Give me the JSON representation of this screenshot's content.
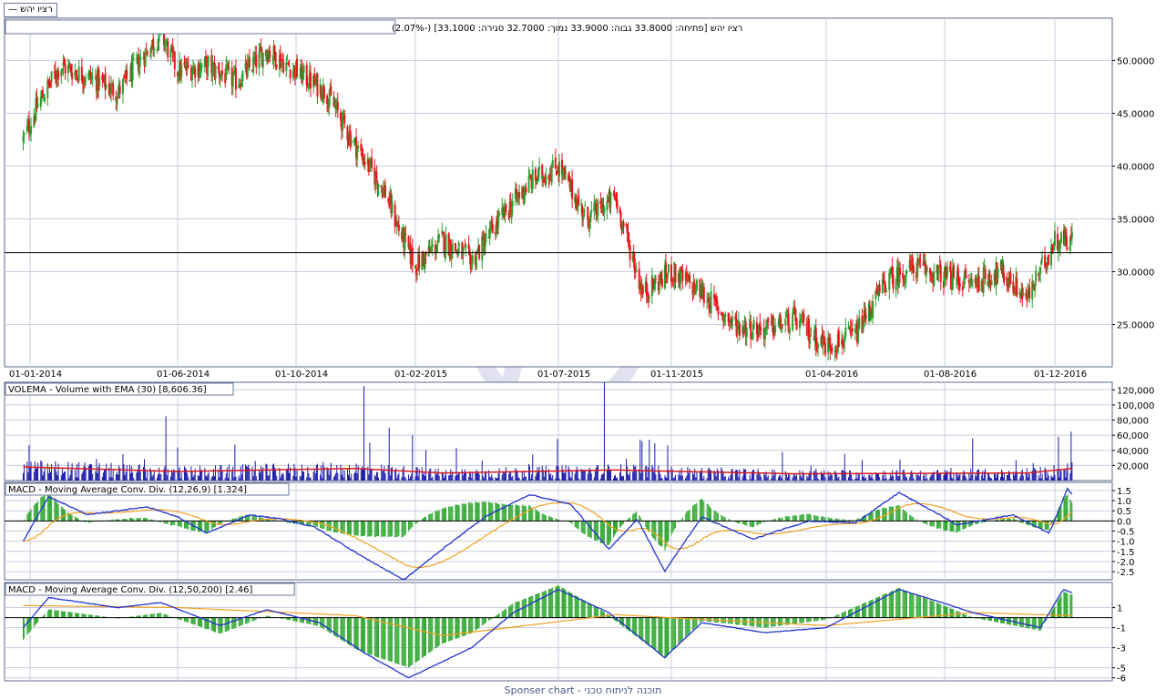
{
  "legend_label": "רציו יהש —",
  "info_bar": "רציו יהש [פתיחה: 33.8000  גבוה: 33.9000  נמוך: 32.7000  סגירה: 33.1000] (-2.07%)",
  "footer": "Sponser chart - תוכנה לניתוח טכני",
  "colors": {
    "up": "#2e9e2e",
    "down": "#e8141a",
    "volume": "#1a1aa8",
    "ema": "#d81a1a",
    "macd": "#2233cc",
    "signal": "#f0a020",
    "hist": "#32a832",
    "grid": "#c8cce0"
  },
  "chart_data": [
    {
      "type": "candlestick",
      "title": "רציו יהש",
      "x_ticks": [
        "01-01-2014",
        "01-06-2014",
        "01-10-2014",
        "01-02-2015",
        "01-07-2015",
        "01-11-2015",
        "01-04-2016",
        "01-08-2016",
        "01-12-2016"
      ],
      "y_ticks": [
        "50.0000",
        "45.0000",
        "40.0000",
        "35.0000",
        "30.0000",
        "25.0000"
      ],
      "ylim": [
        21.0,
        54.0
      ],
      "reference_line": 31.8,
      "keypoints": [
        {
          "date": "2013-12-25",
          "value": 42.5
        },
        {
          "date": "2014-01-10",
          "value": 46
        },
        {
          "date": "2014-02-01",
          "value": 49.5
        },
        {
          "date": "2014-03-01",
          "value": 48.5
        },
        {
          "date": "2014-04-01",
          "value": 47
        },
        {
          "date": "2014-05-01",
          "value": 51
        },
        {
          "date": "2014-05-15",
          "value": 52.5
        },
        {
          "date": "2014-06-01",
          "value": 49
        },
        {
          "date": "2014-07-01",
          "value": 49.5
        },
        {
          "date": "2014-08-01",
          "value": 48
        },
        {
          "date": "2014-09-01",
          "value": 51
        },
        {
          "date": "2014-10-01",
          "value": 49
        },
        {
          "date": "2014-11-01",
          "value": 47
        },
        {
          "date": "2014-12-01",
          "value": 42
        },
        {
          "date": "2015-01-01",
          "value": 37.5
        },
        {
          "date": "2015-01-15",
          "value": 34
        },
        {
          "date": "2015-02-01",
          "value": 30.5
        },
        {
          "date": "2015-03-01",
          "value": 33
        },
        {
          "date": "2015-04-01",
          "value": 31
        },
        {
          "date": "2015-05-01",
          "value": 35
        },
        {
          "date": "2015-06-01",
          "value": 38.5
        },
        {
          "date": "2015-07-01",
          "value": 40
        },
        {
          "date": "2015-08-01",
          "value": 35
        },
        {
          "date": "2015-09-01",
          "value": 37
        },
        {
          "date": "2015-10-01",
          "value": 28
        },
        {
          "date": "2015-11-01",
          "value": 30
        },
        {
          "date": "2015-12-01",
          "value": 28
        },
        {
          "date": "2016-01-01",
          "value": 25
        },
        {
          "date": "2016-02-01",
          "value": 24.5
        },
        {
          "date": "2016-03-01",
          "value": 25.5
        },
        {
          "date": "2016-04-01",
          "value": 23
        },
        {
          "date": "2016-05-01",
          "value": 24
        },
        {
          "date": "2016-06-01",
          "value": 29
        },
        {
          "date": "2016-07-01",
          "value": 30.5
        },
        {
          "date": "2016-08-01",
          "value": 29.5
        },
        {
          "date": "2016-09-01",
          "value": 29
        },
        {
          "date": "2016-10-01",
          "value": 30
        },
        {
          "date": "2016-11-01",
          "value": 27.5
        },
        {
          "date": "2016-12-01",
          "value": 33
        },
        {
          "date": "2016-12-20",
          "value": 33.1
        }
      ]
    },
    {
      "type": "bar",
      "title": "VOLEMA - Volume with EMA (30) [8,606.36]",
      "y_ticks": [
        "120,000",
        "100,000",
        "80,000",
        "60,000",
        "40,000",
        "20,000"
      ],
      "ylim": [
        0,
        130000
      ],
      "series": [
        {
          "name": "Volume"
        },
        {
          "name": "EMA (30)"
        }
      ],
      "ema_keypoints": [
        {
          "date": "2013-12-25",
          "value": 18000
        },
        {
          "date": "2014-06-01",
          "value": 12000
        },
        {
          "date": "2014-12-01",
          "value": 16000
        },
        {
          "date": "2015-03-01",
          "value": 10000
        },
        {
          "date": "2015-09-01",
          "value": 14000
        },
        {
          "date": "2016-03-01",
          "value": 9000
        },
        {
          "date": "2016-11-01",
          "value": 10000
        },
        {
          "date": "2016-12-20",
          "value": 16000
        }
      ],
      "spikes": [
        {
          "date": "2014-05-20",
          "value": 85000
        },
        {
          "date": "2014-12-10",
          "value": 125000
        },
        {
          "date": "2015-01-05",
          "value": 70000
        },
        {
          "date": "2015-04-25",
          "value": 60000
        },
        {
          "date": "2015-08-20",
          "value": 130000
        },
        {
          "date": "2016-03-25",
          "value": 105000
        },
        {
          "date": "2016-12-05",
          "value": 58000
        }
      ]
    },
    {
      "type": "line",
      "title": "MACD - Moving Average Conv. Div. (12,26,9) [1.324]",
      "y_ticks": [
        "1.5",
        "1.0",
        "0.5",
        "0.0",
        "-0.5",
        "-1.0",
        "-1.5",
        "-2.0",
        "-2.5"
      ],
      "ylim": [
        -2.9,
        1.9
      ],
      "series": [
        {
          "name": "MACD"
        },
        {
          "name": "Signal"
        }
      ],
      "macd_keypoints": [
        {
          "date": "2013-12-25",
          "value": -1.0
        },
        {
          "date": "2014-01-20",
          "value": 1.2
        },
        {
          "date": "2014-03-01",
          "value": 0.3
        },
        {
          "date": "2014-05-01",
          "value": 0.7
        },
        {
          "date": "2014-06-01",
          "value": 0.2
        },
        {
          "date": "2014-07-01",
          "value": -0.6
        },
        {
          "date": "2014-08-15",
          "value": 0.3
        },
        {
          "date": "2014-09-15",
          "value": 0.1
        },
        {
          "date": "2014-10-20",
          "value": -0.3
        },
        {
          "date": "2014-12-10",
          "value": -1.8
        },
        {
          "date": "2015-01-20",
          "value": -2.9
        },
        {
          "date": "2015-03-01",
          "value": -1.4
        },
        {
          "date": "2015-04-15",
          "value": 0.2
        },
        {
          "date": "2015-06-01",
          "value": 1.3
        },
        {
          "date": "2015-07-15",
          "value": 0.8
        },
        {
          "date": "2015-08-25",
          "value": -1.4
        },
        {
          "date": "2015-09-25",
          "value": 0.1
        },
        {
          "date": "2015-10-25",
          "value": -2.5
        },
        {
          "date": "2015-12-01",
          "value": 0.2
        },
        {
          "date": "2016-01-20",
          "value": -0.9
        },
        {
          "date": "2016-03-15",
          "value": 0.0
        },
        {
          "date": "2016-05-01",
          "value": -0.1
        },
        {
          "date": "2016-06-15",
          "value": 1.4
        },
        {
          "date": "2016-08-15",
          "value": -0.2
        },
        {
          "date": "2016-10-15",
          "value": 0.3
        },
        {
          "date": "2016-11-25",
          "value": -0.6
        },
        {
          "date": "2016-12-15",
          "value": 1.6
        },
        {
          "date": "2016-12-20",
          "value": 1.3
        }
      ]
    },
    {
      "type": "line",
      "title": "MACD - Moving Average Conv. Div. (12,50,200) [2.46]",
      "y_ticks": [
        "1",
        "-1",
        "-3",
        "-5",
        "-6"
      ],
      "ylim": [
        -6.3,
        3.5
      ],
      "series": [
        {
          "name": "MACD"
        },
        {
          "name": "Signal"
        }
      ],
      "macd_keypoints": [
        {
          "date": "2013-12-25",
          "value": -1.0
        },
        {
          "date": "2014-01-20",
          "value": 2.0
        },
        {
          "date": "2014-04-01",
          "value": 1.0
        },
        {
          "date": "2014-05-15",
          "value": 1.5
        },
        {
          "date": "2014-07-15",
          "value": -0.8
        },
        {
          "date": "2014-09-01",
          "value": 0.8
        },
        {
          "date": "2014-10-25",
          "value": -0.5
        },
        {
          "date": "2014-12-10",
          "value": -3.5
        },
        {
          "date": "2015-01-25",
          "value": -6.0
        },
        {
          "date": "2015-04-01",
          "value": -3.0
        },
        {
          "date": "2015-05-15",
          "value": 0.5
        },
        {
          "date": "2015-07-01",
          "value": 2.8
        },
        {
          "date": "2015-08-25",
          "value": 0.5
        },
        {
          "date": "2015-10-25",
          "value": -4.0
        },
        {
          "date": "2015-12-01",
          "value": -0.5
        },
        {
          "date": "2016-02-01",
          "value": -1.5
        },
        {
          "date": "2016-04-01",
          "value": -1.0
        },
        {
          "date": "2016-06-15",
          "value": 2.8
        },
        {
          "date": "2016-09-01",
          "value": 0.5
        },
        {
          "date": "2016-11-15",
          "value": -1.0
        },
        {
          "date": "2016-12-10",
          "value": 2.8
        },
        {
          "date": "2016-12-20",
          "value": 2.5
        }
      ],
      "signal_keypoints": [
        {
          "date": "2013-12-25",
          "value": 1.2
        },
        {
          "date": "2014-06-01",
          "value": 1.0
        },
        {
          "date": "2014-12-01",
          "value": 0.2
        },
        {
          "date": "2015-03-01",
          "value": -1.8
        },
        {
          "date": "2015-09-01",
          "value": 0.3
        },
        {
          "date": "2016-04-01",
          "value": -0.8
        },
        {
          "date": "2016-09-01",
          "value": 0.5
        },
        {
          "date": "2016-12-20",
          "value": 0.2
        }
      ]
    }
  ]
}
